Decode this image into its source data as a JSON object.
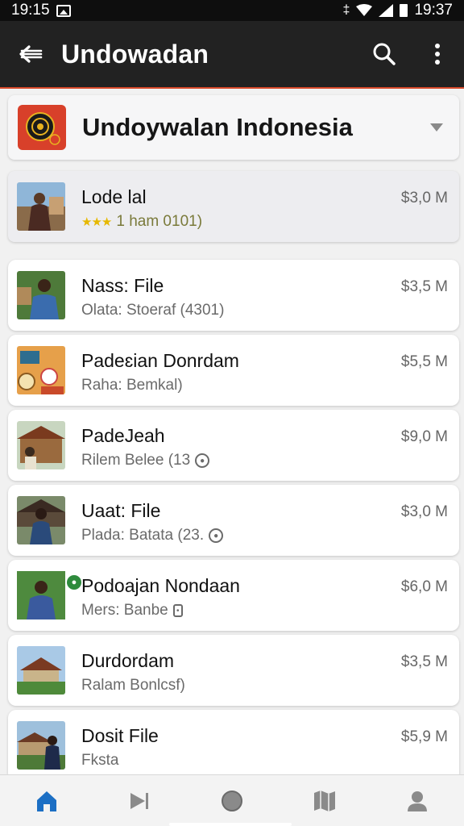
{
  "status_bar": {
    "time_left": "19:15",
    "time_right": "19:37"
  },
  "app_bar": {
    "title": "Undowadan",
    "back_icon": "back-arrow-icon",
    "search_icon": "search-icon",
    "more_icon": "more-vert-icon"
  },
  "header": {
    "title": "Undoywalan Indonesia",
    "logo_icon": "emblem-logo",
    "accent_color": "#d8402a"
  },
  "featured": {
    "title": "Lode lal",
    "subtitle": "1 ham 0101)",
    "stars": "★★★",
    "price": "$3,0 M"
  },
  "items": [
    {
      "title": "Nass: File",
      "subtitle": "Olata: Stoeraf (4301)",
      "price": "$3,5 M"
    },
    {
      "title": "Padeɛian Donrdam",
      "subtitle": "Raha: Bemkal)",
      "price": "$5,5 M"
    },
    {
      "title": "PadeJeah",
      "subtitle": "Rilem Belee (13",
      "price": "$9,0 M"
    },
    {
      "title": "Uaat: File",
      "subtitle": "Plada: Batata (23.",
      "price": "$3,0 M"
    },
    {
      "title": "Podoajan Nondaan",
      "subtitle": "Mers: Banbe",
      "price": "$6,0 M"
    },
    {
      "title": "Durdordam",
      "subtitle": "Ralam Bonlcsf)",
      "price": "$3,5 M"
    },
    {
      "title": "Dosit File",
      "subtitle": "Fksta",
      "price": "$5,9 M"
    }
  ],
  "bottom_nav": {
    "items": [
      "home-icon",
      "play-icon",
      "circle-icon",
      "map-icon",
      "profile-icon"
    ],
    "active_color": "#1c6fc4",
    "inactive_color": "#8a8a8a"
  }
}
